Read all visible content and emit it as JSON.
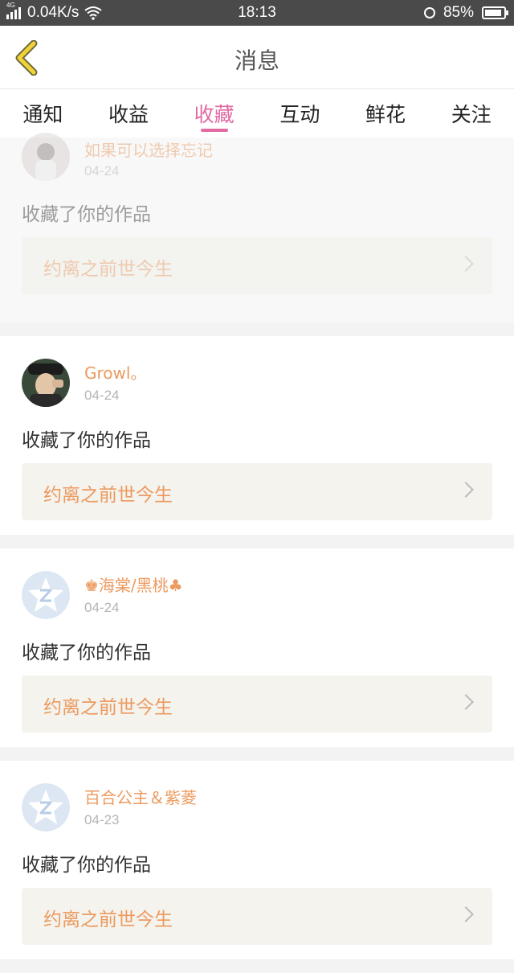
{
  "status_bar": {
    "network": "4G",
    "speed": "0.04K/s",
    "time": "18:13",
    "battery": "85%"
  },
  "nav": {
    "title": "消息",
    "back_icon": "chevron-left-icon"
  },
  "tabs": [
    {
      "label": "通知",
      "active": false
    },
    {
      "label": "收益",
      "active": false
    },
    {
      "label": "收藏",
      "active": true
    },
    {
      "label": "互动",
      "active": false
    },
    {
      "label": "鲜花",
      "active": false
    },
    {
      "label": "关注",
      "active": false
    }
  ],
  "colors": {
    "accent": "#e26aa3",
    "username": "#ec9a5f",
    "work_box": "#f4f3ee"
  },
  "messages": [
    {
      "user": "如果可以选择忘记",
      "date": "04-24",
      "action": "收藏了你的作品",
      "work": "约离之前世今生",
      "avatar": "photo-girl"
    },
    {
      "user": "Growl。",
      "date": "04-24",
      "action": "收藏了你的作品",
      "work": "约离之前世今生",
      "avatar": "photo-boy"
    },
    {
      "user": "♚海棠/黑桃♣",
      "date": "04-24",
      "action": "收藏了你的作品",
      "work": "约离之前世今生",
      "avatar": "default-star-avatar"
    },
    {
      "user": "百合公主＆紫菱",
      "date": "04-23",
      "action": "收藏了你的作品",
      "work": "约离之前世今生",
      "avatar": "default-star-avatar"
    }
  ]
}
